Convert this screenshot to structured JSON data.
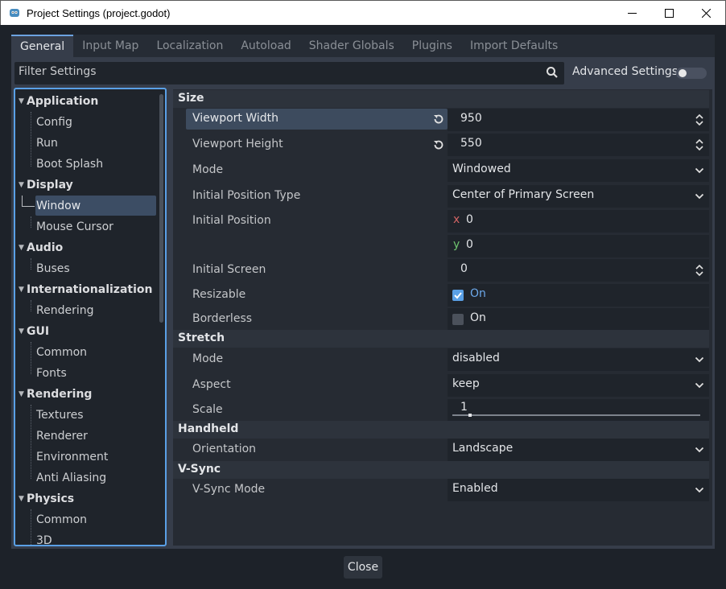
{
  "window": {
    "title": "Project Settings (project.godot)"
  },
  "tabs": [
    "General",
    "Input Map",
    "Localization",
    "Autoload",
    "Shader Globals",
    "Plugins",
    "Import Defaults"
  ],
  "filter": {
    "placeholder": "Filter Settings"
  },
  "advanced": {
    "label": "Advanced Settings",
    "enabled": false
  },
  "tree": {
    "items": [
      {
        "label": "Application",
        "kind": "category"
      },
      {
        "label": "Config",
        "kind": "sub"
      },
      {
        "label": "Run",
        "kind": "sub"
      },
      {
        "label": "Boot Splash",
        "kind": "sub"
      },
      {
        "label": "Display",
        "kind": "category"
      },
      {
        "label": "Window",
        "kind": "sub",
        "selected": true
      },
      {
        "label": "Mouse Cursor",
        "kind": "sub"
      },
      {
        "label": "Audio",
        "kind": "category"
      },
      {
        "label": "Buses",
        "kind": "sub"
      },
      {
        "label": "Internationalization",
        "kind": "category"
      },
      {
        "label": "Rendering",
        "kind": "sub"
      },
      {
        "label": "GUI",
        "kind": "category"
      },
      {
        "label": "Common",
        "kind": "sub"
      },
      {
        "label": "Fonts",
        "kind": "sub"
      },
      {
        "label": "Rendering",
        "kind": "category"
      },
      {
        "label": "Textures",
        "kind": "sub"
      },
      {
        "label": "Renderer",
        "kind": "sub"
      },
      {
        "label": "Environment",
        "kind": "sub"
      },
      {
        "label": "Anti Aliasing",
        "kind": "sub"
      },
      {
        "label": "Physics",
        "kind": "category"
      },
      {
        "label": "Common",
        "kind": "sub"
      },
      {
        "label": "3D",
        "kind": "sub"
      }
    ]
  },
  "sections": {
    "size": "Size",
    "stretch": "Stretch",
    "handheld": "Handheld",
    "vsync": "V-Sync"
  },
  "props": {
    "viewport_width": {
      "label": "Viewport Width",
      "value": "950"
    },
    "viewport_height": {
      "label": "Viewport Height",
      "value": "550"
    },
    "mode": {
      "label": "Mode",
      "value": "Windowed"
    },
    "initial_position_type": {
      "label": "Initial Position Type",
      "value": "Center of Primary Screen"
    },
    "initial_position": {
      "label": "Initial Position",
      "x_label": "x",
      "x": "0",
      "y_label": "y",
      "y": "0"
    },
    "initial_screen": {
      "label": "Initial Screen",
      "value": "0"
    },
    "resizable": {
      "label": "Resizable",
      "value": "On",
      "checked": true
    },
    "borderless": {
      "label": "Borderless",
      "value": "On",
      "checked": false
    },
    "stretch_mode": {
      "label": "Mode",
      "value": "disabled"
    },
    "aspect": {
      "label": "Aspect",
      "value": "keep"
    },
    "scale": {
      "label": "Scale",
      "value": "1"
    },
    "orientation": {
      "label": "Orientation",
      "value": "Landscape"
    },
    "vsync_mode": {
      "label": "V-Sync Mode",
      "value": "Enabled"
    }
  },
  "footer": {
    "close_label": "Close"
  },
  "colors": {
    "accent": "#6ca3e0",
    "selection": "#3c4d64",
    "check": "#5aa0e6"
  }
}
